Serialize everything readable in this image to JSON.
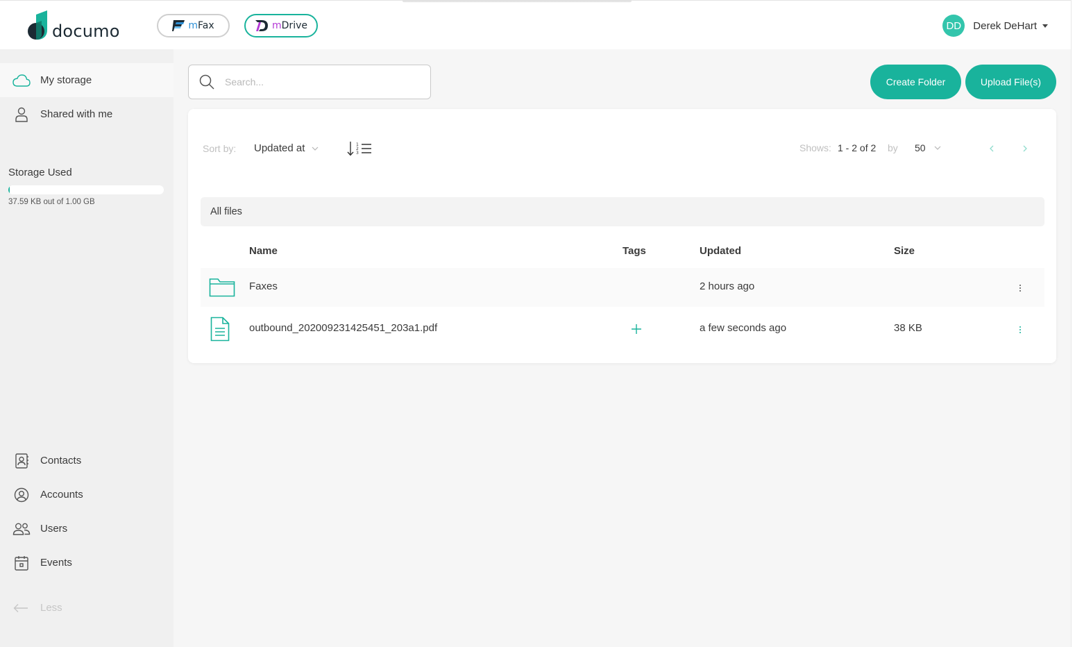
{
  "header": {
    "logo_text": "documo",
    "apps": [
      {
        "name": "mFax",
        "prefix": "m",
        "rest": "Fax"
      },
      {
        "name": "mDrive",
        "prefix": "m",
        "rest": "Drive"
      }
    ],
    "user": {
      "initials": "DD",
      "name": "Derek DeHart"
    }
  },
  "sidebar": {
    "primary": [
      {
        "label": "My storage",
        "icon": "cloud-icon",
        "active": true
      },
      {
        "label": "Shared with me",
        "icon": "person-icon",
        "active": false
      }
    ],
    "storage": {
      "title": "Storage Used",
      "text": "37.59 KB out of 1.00 GB",
      "used_fraction": 3.58e-05
    },
    "secondary": [
      {
        "label": "Contacts",
        "icon": "contacts-icon"
      },
      {
        "label": "Accounts",
        "icon": "account-icon"
      },
      {
        "label": "Users",
        "icon": "users-icon"
      },
      {
        "label": "Events",
        "icon": "calendar-icon"
      }
    ],
    "less_label": "Less"
  },
  "search": {
    "placeholder": "Search..."
  },
  "actions": {
    "create_folder": "Create Folder",
    "upload_files": "Upload File(s)"
  },
  "toolbar": {
    "sort_label": "Sort by:",
    "sort_value": "Updated at",
    "shows_label": "Shows:",
    "shows_range": "1 - 2 of 2",
    "by_label": "by",
    "per_page": "50"
  },
  "breadcrumb": "All files",
  "table": {
    "columns": {
      "name": "Name",
      "tags": "Tags",
      "updated": "Updated",
      "size": "Size"
    },
    "rows": [
      {
        "type": "folder",
        "name": "Faxes",
        "updated": "2 hours ago",
        "size": ""
      },
      {
        "type": "file",
        "name": "outbound_202009231425451_203a1.pdf",
        "updated": "a few seconds ago",
        "size": "38 KB"
      }
    ]
  },
  "colors": {
    "accent": "#19b39c",
    "avatar": "#33c5ac",
    "mfax": "#2c8fd6",
    "mdrive": "#b53ad6"
  }
}
